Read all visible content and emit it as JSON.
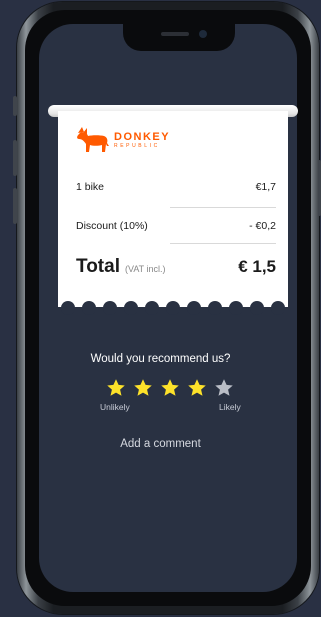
{
  "receipt": {
    "brand_line1": "DONKEY",
    "brand_line2": "REPUBLIC",
    "items": [
      {
        "label": "1 bike",
        "value": "€1,7"
      },
      {
        "label": "Discount (10%)",
        "value": "- €0,2"
      }
    ],
    "total_label": "Total",
    "total_note": "(VAT incl.)",
    "total_value": "€ 1,5"
  },
  "rating": {
    "question": "Would you recommend us?",
    "stars_total": 5,
    "stars_selected": 4,
    "low_label": "Unlikely",
    "high_label": "Likely",
    "star_active_color": "#fde22a",
    "star_inactive_color": "#b9bdc6"
  },
  "comment": {
    "label": "Add a comment"
  },
  "colors": {
    "brand": "#ff5a00",
    "background": "#293142"
  }
}
